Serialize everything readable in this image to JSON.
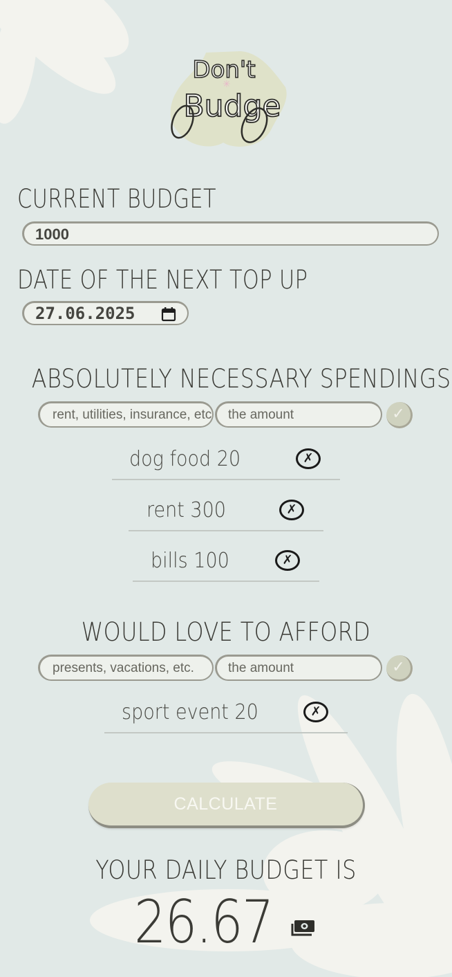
{
  "logo": {
    "line1": "Don't",
    "line2": "Budge"
  },
  "current_budget": {
    "label": "CURRENT BUDGET",
    "value": "1000"
  },
  "next_top_up": {
    "label": "DATE OF THE NEXT TOP UP",
    "value": "27.06.2025"
  },
  "necessary": {
    "title": "ABSOLUTELY NECESSARY SPENDINGS",
    "name_placeholder": "rent, utilities, insurance, etc.",
    "amount_placeholder": "the amount",
    "items": [
      {
        "label": "dog food 20",
        "delete": "✗"
      },
      {
        "label": "rent 300",
        "delete": "✗"
      },
      {
        "label": "bills 100",
        "delete": "✗"
      }
    ]
  },
  "wishes": {
    "title": "WOULD LOVE TO AFFORD",
    "name_placeholder": "presents, vacations, etc.",
    "amount_placeholder": "the amount",
    "items": [
      {
        "label": "sport event 20",
        "delete": "✗"
      }
    ]
  },
  "check_glyph": "✓",
  "calculate_label": "CALCULATE",
  "result": {
    "label": "YOUR DAILY BUDGET IS",
    "value": "26.67",
    "icon": "money-icon"
  },
  "colors": {
    "background": "#e1e9e7",
    "petal": "#f3f3ee",
    "button": "#dedfcc",
    "text": "#3b3b36"
  }
}
